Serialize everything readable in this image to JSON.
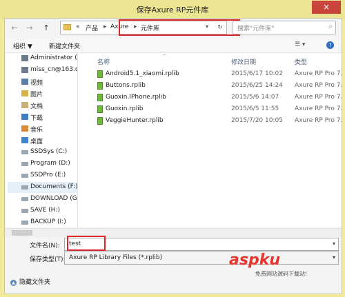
{
  "window": {
    "title": "保存Axure RP元件库",
    "close_glyph": "×"
  },
  "nav": {
    "back": "←",
    "forward": "→",
    "up": "↑",
    "address": {
      "prefix": "«",
      "items": [
        "产品",
        "Axure",
        "元件库"
      ]
    },
    "search_placeholder": "搜索\"元件库\""
  },
  "toolbar": {
    "organize": "组织 ▼",
    "new_folder": "新建文件夹"
  },
  "sidebar": {
    "items": [
      {
        "label": "Administrator (c",
        "icon": "network-icon"
      },
      {
        "label": "miss_cn@163.cc",
        "icon": "network-icon"
      },
      {
        "label": "视频",
        "icon": "video-folder-icon"
      },
      {
        "label": "图片",
        "icon": "picture-folder-icon"
      },
      {
        "label": "文档",
        "icon": "document-folder-icon"
      },
      {
        "label": "下载",
        "icon": "download-folder-icon"
      },
      {
        "label": "音乐",
        "icon": "music-folder-icon"
      },
      {
        "label": "桌面",
        "icon": "desktop-folder-icon"
      },
      {
        "label": "SSDSys (C:)",
        "icon": "drive-icon"
      },
      {
        "label": "Program (D:)",
        "icon": "drive-icon"
      },
      {
        "label": "SSDPro (E:)",
        "icon": "drive-icon"
      },
      {
        "label": "Documents (F:)",
        "icon": "drive-icon"
      },
      {
        "label": "DOWNLOAD (G",
        "icon": "drive-icon"
      },
      {
        "label": "SAVE (H:)",
        "icon": "drive-icon"
      },
      {
        "label": "BACKUP (I:)",
        "icon": "drive-icon"
      }
    ]
  },
  "columns": {
    "name": "名称",
    "date": "修改日期",
    "type": "类型"
  },
  "files": [
    {
      "name": "Android5.1_xiaomi.rplib",
      "date": "2015/6/17 10:02",
      "type": "Axure RP Pro 7."
    },
    {
      "name": "Buttons.rplib",
      "date": "2015/6/25 14:24",
      "type": "Axure RP Pro 7."
    },
    {
      "name": "Guoxin.IPhone.rplib",
      "date": "2015/5/6 14:07",
      "type": "Axure RP Pro 7."
    },
    {
      "name": "Guoxin.rplib",
      "date": "2015/6/5 11:55",
      "type": "Axure RP Pro 7."
    },
    {
      "name": "VeggieHunter.rplib",
      "date": "2015/7/20 10:05",
      "type": "Axure RP Pro 7."
    }
  ],
  "filename": {
    "label": "文件名(N):",
    "value": "test"
  },
  "filetype": {
    "label": "保存类型(T):",
    "value": "Axure RP Library Files (*.rplib)"
  },
  "footer": {
    "hide_folders": "隐藏文件夹"
  },
  "watermark": {
    "main": "aspku",
    "sub": "免费网站源码下载站!"
  },
  "colors": {
    "highlight": "#e0252a",
    "title_bg": "#ece592"
  }
}
